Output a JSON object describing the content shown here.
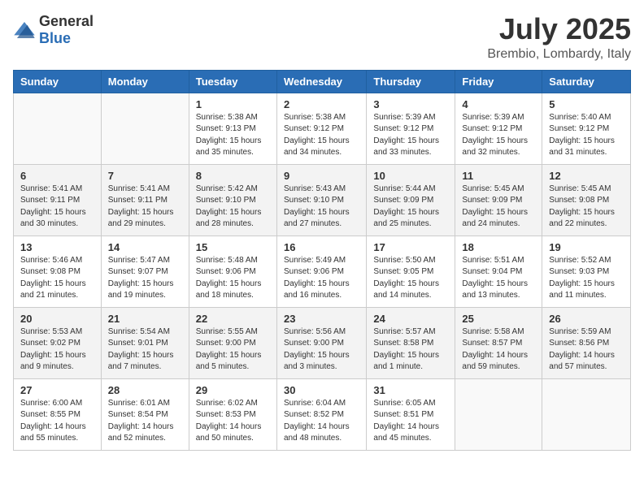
{
  "header": {
    "logo": {
      "general": "General",
      "blue": "Blue"
    },
    "title": "July 2025",
    "location": "Brembio, Lombardy, Italy"
  },
  "weekdays": [
    "Sunday",
    "Monday",
    "Tuesday",
    "Wednesday",
    "Thursday",
    "Friday",
    "Saturday"
  ],
  "weeks": [
    [
      {
        "day": "",
        "info": ""
      },
      {
        "day": "",
        "info": ""
      },
      {
        "day": "1",
        "info": "Sunrise: 5:38 AM\nSunset: 9:13 PM\nDaylight: 15 hours and 35 minutes."
      },
      {
        "day": "2",
        "info": "Sunrise: 5:38 AM\nSunset: 9:12 PM\nDaylight: 15 hours and 34 minutes."
      },
      {
        "day": "3",
        "info": "Sunrise: 5:39 AM\nSunset: 9:12 PM\nDaylight: 15 hours and 33 minutes."
      },
      {
        "day": "4",
        "info": "Sunrise: 5:39 AM\nSunset: 9:12 PM\nDaylight: 15 hours and 32 minutes."
      },
      {
        "day": "5",
        "info": "Sunrise: 5:40 AM\nSunset: 9:12 PM\nDaylight: 15 hours and 31 minutes."
      }
    ],
    [
      {
        "day": "6",
        "info": "Sunrise: 5:41 AM\nSunset: 9:11 PM\nDaylight: 15 hours and 30 minutes."
      },
      {
        "day": "7",
        "info": "Sunrise: 5:41 AM\nSunset: 9:11 PM\nDaylight: 15 hours and 29 minutes."
      },
      {
        "day": "8",
        "info": "Sunrise: 5:42 AM\nSunset: 9:10 PM\nDaylight: 15 hours and 28 minutes."
      },
      {
        "day": "9",
        "info": "Sunrise: 5:43 AM\nSunset: 9:10 PM\nDaylight: 15 hours and 27 minutes."
      },
      {
        "day": "10",
        "info": "Sunrise: 5:44 AM\nSunset: 9:09 PM\nDaylight: 15 hours and 25 minutes."
      },
      {
        "day": "11",
        "info": "Sunrise: 5:45 AM\nSunset: 9:09 PM\nDaylight: 15 hours and 24 minutes."
      },
      {
        "day": "12",
        "info": "Sunrise: 5:45 AM\nSunset: 9:08 PM\nDaylight: 15 hours and 22 minutes."
      }
    ],
    [
      {
        "day": "13",
        "info": "Sunrise: 5:46 AM\nSunset: 9:08 PM\nDaylight: 15 hours and 21 minutes."
      },
      {
        "day": "14",
        "info": "Sunrise: 5:47 AM\nSunset: 9:07 PM\nDaylight: 15 hours and 19 minutes."
      },
      {
        "day": "15",
        "info": "Sunrise: 5:48 AM\nSunset: 9:06 PM\nDaylight: 15 hours and 18 minutes."
      },
      {
        "day": "16",
        "info": "Sunrise: 5:49 AM\nSunset: 9:06 PM\nDaylight: 15 hours and 16 minutes."
      },
      {
        "day": "17",
        "info": "Sunrise: 5:50 AM\nSunset: 9:05 PM\nDaylight: 15 hours and 14 minutes."
      },
      {
        "day": "18",
        "info": "Sunrise: 5:51 AM\nSunset: 9:04 PM\nDaylight: 15 hours and 13 minutes."
      },
      {
        "day": "19",
        "info": "Sunrise: 5:52 AM\nSunset: 9:03 PM\nDaylight: 15 hours and 11 minutes."
      }
    ],
    [
      {
        "day": "20",
        "info": "Sunrise: 5:53 AM\nSunset: 9:02 PM\nDaylight: 15 hours and 9 minutes."
      },
      {
        "day": "21",
        "info": "Sunrise: 5:54 AM\nSunset: 9:01 PM\nDaylight: 15 hours and 7 minutes."
      },
      {
        "day": "22",
        "info": "Sunrise: 5:55 AM\nSunset: 9:00 PM\nDaylight: 15 hours and 5 minutes."
      },
      {
        "day": "23",
        "info": "Sunrise: 5:56 AM\nSunset: 9:00 PM\nDaylight: 15 hours and 3 minutes."
      },
      {
        "day": "24",
        "info": "Sunrise: 5:57 AM\nSunset: 8:58 PM\nDaylight: 15 hours and 1 minute."
      },
      {
        "day": "25",
        "info": "Sunrise: 5:58 AM\nSunset: 8:57 PM\nDaylight: 14 hours and 59 minutes."
      },
      {
        "day": "26",
        "info": "Sunrise: 5:59 AM\nSunset: 8:56 PM\nDaylight: 14 hours and 57 minutes."
      }
    ],
    [
      {
        "day": "27",
        "info": "Sunrise: 6:00 AM\nSunset: 8:55 PM\nDaylight: 14 hours and 55 minutes."
      },
      {
        "day": "28",
        "info": "Sunrise: 6:01 AM\nSunset: 8:54 PM\nDaylight: 14 hours and 52 minutes."
      },
      {
        "day": "29",
        "info": "Sunrise: 6:02 AM\nSunset: 8:53 PM\nDaylight: 14 hours and 50 minutes."
      },
      {
        "day": "30",
        "info": "Sunrise: 6:04 AM\nSunset: 8:52 PM\nDaylight: 14 hours and 48 minutes."
      },
      {
        "day": "31",
        "info": "Sunrise: 6:05 AM\nSunset: 8:51 PM\nDaylight: 14 hours and 45 minutes."
      },
      {
        "day": "",
        "info": ""
      },
      {
        "day": "",
        "info": ""
      }
    ]
  ]
}
